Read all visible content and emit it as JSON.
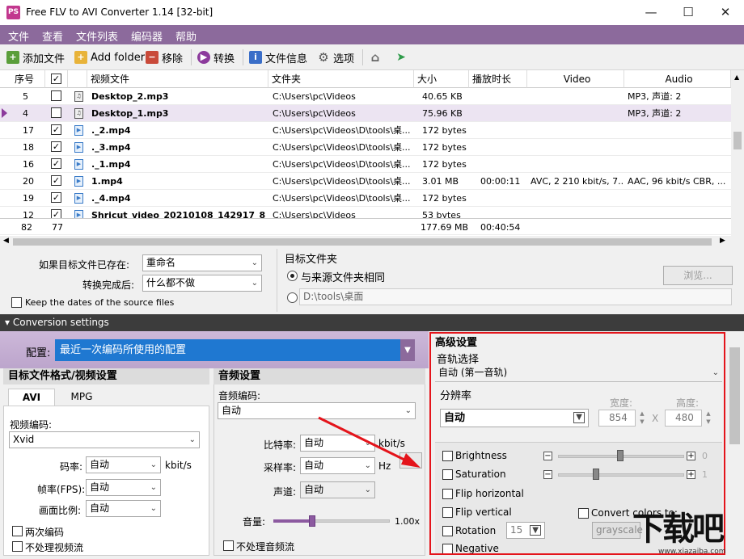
{
  "window": {
    "title": "Free FLV to AVI Converter 1.14  [32-bit]",
    "icon_text": "PS"
  },
  "menu": [
    "文件",
    "查看",
    "文件列表",
    "编码器",
    "帮助"
  ],
  "toolbar": {
    "add_file": "添加文件",
    "add_folder": "Add folder",
    "remove": "移除",
    "convert": "转换",
    "file_info": "文件信息",
    "options": "选项"
  },
  "table": {
    "columns": [
      "序号",
      "",
      "",
      "视频文件",
      "文件夹",
      "大小",
      "播放时长",
      "Video",
      "Audio"
    ],
    "rows": [
      {
        "num": "5",
        "checked": false,
        "name": "Desktop_2.mp3",
        "folder": "C:\\Users\\pc\\Videos",
        "size": "40.65 KB",
        "duration": "",
        "video": "",
        "audio": "MP3, 声道: 2",
        "kind": "audio"
      },
      {
        "num": "4",
        "checked": false,
        "name": "Desktop_1.mp3",
        "folder": "C:\\Users\\pc\\Videos",
        "size": "75.96 KB",
        "duration": "",
        "video": "",
        "audio": "MP3, 声道: 2",
        "kind": "audio",
        "selected": true
      },
      {
        "num": "17",
        "checked": true,
        "name": "._2.mp4",
        "folder": "C:\\Users\\pc\\Videos\\D\\tools\\桌...",
        "size": "172 bytes",
        "duration": "",
        "video": "",
        "audio": "",
        "kind": "video"
      },
      {
        "num": "18",
        "checked": true,
        "name": "._3.mp4",
        "folder": "C:\\Users\\pc\\Videos\\D\\tools\\桌...",
        "size": "172 bytes",
        "duration": "",
        "video": "",
        "audio": "",
        "kind": "video"
      },
      {
        "num": "16",
        "checked": true,
        "name": "._1.mp4",
        "folder": "C:\\Users\\pc\\Videos\\D\\tools\\桌...",
        "size": "172 bytes",
        "duration": "",
        "video": "",
        "audio": "",
        "kind": "video"
      },
      {
        "num": "20",
        "checked": true,
        "name": "1.mp4",
        "folder": "C:\\Users\\pc\\Videos\\D\\tools\\桌...",
        "size": "3.01 MB",
        "duration": "00:00:11",
        "video": "AVC, 2 210 kbit/s, 7...",
        "audio": "AAC, 96 kbit/s CBR, ...",
        "kind": "video"
      },
      {
        "num": "19",
        "checked": true,
        "name": "._4.mp4",
        "folder": "C:\\Users\\pc\\Videos\\D\\tools\\桌...",
        "size": "172 bytes",
        "duration": "",
        "video": "",
        "audio": "",
        "kind": "video"
      },
      {
        "num": "12",
        "checked": true,
        "name": "Shricut_video_20210108_142917_893.mp4",
        "folder": "C:\\Users\\pc\\Videos",
        "size": "53 bytes",
        "duration": "",
        "video": "",
        "audio": "",
        "kind": "video"
      }
    ],
    "footer": {
      "count": "82",
      "checked": "77",
      "size": "177.69 MB",
      "duration": "00:40:54"
    }
  },
  "file_options": {
    "if_exists_label": "如果目标文件已存在:",
    "if_exists_value": "重命名",
    "after_label": "转换完成后:",
    "after_value": "什么都不做",
    "keep_dates": "Keep the dates of the source files",
    "target_folder_label": "目标文件夹",
    "same_as_source": "与来源文件夹相同",
    "custom_path": "D:\\tools\\桌面",
    "browse": "浏览..."
  },
  "conversion": {
    "header": "Conversion settings",
    "profile_label": "配置:",
    "profile_value": "最近一次编码所使用的配置"
  },
  "video_panel": {
    "title": "目标文件格式/视频设置",
    "tabs": [
      "AVI",
      "MPG"
    ],
    "codec_label": "视频编码:",
    "codec_value": "Xvid",
    "bitrate_label": "码率:",
    "bitrate_value": "自动",
    "bitrate_unit": "kbit/s",
    "fps_label": "帧率(FPS):",
    "fps_value": "自动",
    "aspect_label": "画面比例:",
    "aspect_value": "自动",
    "two_pass": "两次编码",
    "no_video": "不处理视频流"
  },
  "audio_panel": {
    "title": "音频设置",
    "codec_label": "音频编码:",
    "codec_value": "自动",
    "bitrate_label": "比特率:",
    "bitrate_value": "自动",
    "bitrate_unit": "kbit/s",
    "samplerate_label": "采样率:",
    "samplerate_value": "自动",
    "samplerate_unit": "Hz",
    "channels_label": "声道:",
    "channels_value": "自动",
    "volume_label": "音量:",
    "volume_value": "1.00x",
    "volume_level": 0.33,
    "no_audio": "不处理音频流"
  },
  "advanced": {
    "title": "高级设置",
    "track_label": "音轨选择",
    "track_value": "自动 (第一音轨)",
    "resolution_label": "分辨率",
    "resolution_value": "自动",
    "width_label": "宽度:",
    "width_value": "854",
    "x_sep": "X",
    "height_label": "高度:",
    "height_value": "480",
    "brightness": "Brightness",
    "brightness_value": "0",
    "saturation": "Saturation",
    "saturation_value": "1",
    "flip_h": "Flip horizontal",
    "flip_v": "Flip vertical",
    "convert_colors": "Convert colors to:",
    "color_mode": "grayscale",
    "rotation": "Rotation",
    "rotation_value": "15",
    "negative": "Negative"
  },
  "watermark": {
    "site": "www.xiazaiba.com",
    "logo_text": "下载吧"
  },
  "colors": {
    "menu_bg": "#8c6a9c",
    "accent": "#1f78d1",
    "highlight_border": "#e4141b"
  }
}
